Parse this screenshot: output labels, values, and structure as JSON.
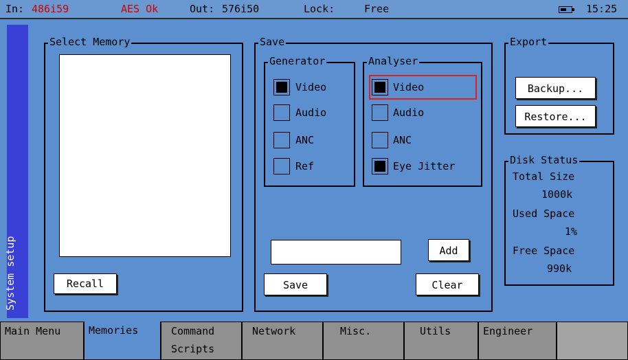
{
  "status_bar": {
    "in_label": "In:",
    "in_value": "486i59",
    "aes_status": "AES Ok",
    "out_label": "Out:",
    "out_value": "576i50",
    "lock_label": "Lock:",
    "lock_value": "Free",
    "time": "15:25"
  },
  "side_label": "System setup",
  "select_memory": {
    "title": "Select Memory",
    "recall_label": "Recall"
  },
  "save": {
    "title": "Save",
    "generator": {
      "title": "Generator",
      "items": [
        {
          "label": "Video",
          "checked": true
        },
        {
          "label": "Audio",
          "checked": false
        },
        {
          "label": "ANC",
          "checked": false
        },
        {
          "label": "Ref",
          "checked": false
        }
      ]
    },
    "analyser": {
      "title": "Analyser",
      "items": [
        {
          "label": "Video",
          "checked": true
        },
        {
          "label": "Audio",
          "checked": false
        },
        {
          "label": "ANC",
          "checked": false
        },
        {
          "label": "Eye Jitter",
          "checked": true
        }
      ]
    },
    "name_value": "",
    "add_label": "Add",
    "save_label": "Save",
    "clear_label": "Clear"
  },
  "export": {
    "title": "Export",
    "backup_label": "Backup...",
    "restore_label": "Restore..."
  },
  "disk_status": {
    "title": "Disk Status",
    "total_size_label": "Total Size",
    "total_size_value": "1000k",
    "used_space_label": "Used Space",
    "used_space_value": "1%",
    "free_space_label": "Free Space",
    "free_space_value": "990k"
  },
  "tabs": [
    {
      "label": "Main Menu",
      "active": false
    },
    {
      "label": "Memories",
      "active": true
    },
    {
      "label": "Command Scripts",
      "active": false
    },
    {
      "label": "Network",
      "active": false
    },
    {
      "label": "Misc.",
      "active": false
    },
    {
      "label": "Utils",
      "active": false
    },
    {
      "label": "Engineer",
      "active": false
    }
  ],
  "colors": {
    "background": "#5b8fcf",
    "side_strip": "#3a3fd6",
    "status_red": "#d00000",
    "highlight": "#e0201c",
    "tab_inactive": "#909090"
  }
}
